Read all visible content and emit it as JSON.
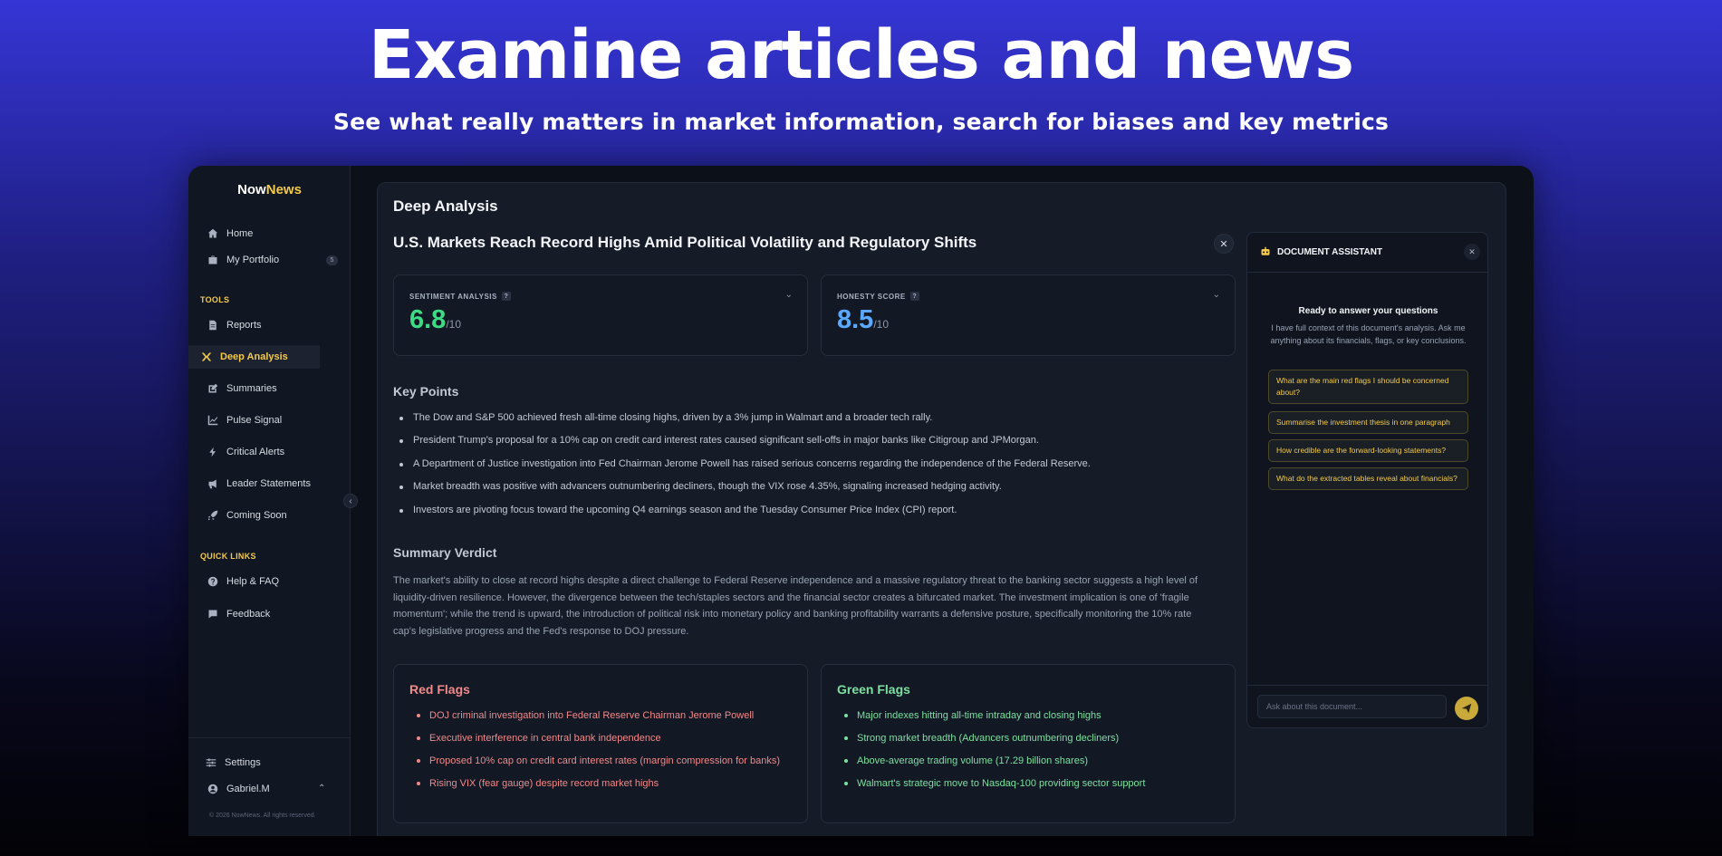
{
  "hero": {
    "title": "Examine articles and news",
    "subtitle": "See what really matters in market information, search for biases and key metrics"
  },
  "brand": {
    "prefix": "Now",
    "highlight": "News"
  },
  "sidebar": {
    "items": [
      {
        "label": "Home",
        "icon": "home-icon"
      },
      {
        "label": "My Portfolio",
        "icon": "briefcase-icon",
        "badge": "5"
      }
    ],
    "tools_label": "TOOLS",
    "tools": [
      {
        "label": "Reports",
        "icon": "document-icon"
      },
      {
        "label": "Deep Analysis",
        "icon": "analysis-icon",
        "active": true
      },
      {
        "label": "Summaries",
        "icon": "edit-icon"
      },
      {
        "label": "Pulse Signal",
        "icon": "chart-line-icon"
      },
      {
        "label": "Critical Alerts",
        "icon": "bolt-icon"
      },
      {
        "label": "Leader Statements",
        "icon": "megaphone-icon"
      },
      {
        "label": "Coming Soon",
        "icon": "rocket-icon"
      }
    ],
    "quick_links_label": "QUICK LINKS",
    "quick_links": [
      {
        "label": "Help & FAQ",
        "icon": "help-icon"
      },
      {
        "label": "Feedback",
        "icon": "chat-icon"
      }
    ],
    "settings_label": "Settings",
    "user_name": "Gabriel.M",
    "copyright": "© 2026 NowNews. All rights reserved."
  },
  "main": {
    "panel_title": "Deep Analysis",
    "article_title": "U.S. Markets Reach Record Highs Amid Political Volatility and Regulatory Shifts",
    "sentiment": {
      "label": "SENTIMENT ANALYSIS",
      "value": "6.8",
      "denominator": "/10",
      "color": "#3ddc84"
    },
    "honesty": {
      "label": "HONESTY SCORE",
      "value": "8.5",
      "denominator": "/10",
      "color": "#5aa9ff"
    },
    "key_points_title": "Key Points",
    "key_points": [
      "The Dow and S&P 500 achieved fresh all-time closing highs, driven by a 3% jump in Walmart and a broader tech rally.",
      "President Trump's proposal for a 10% cap on credit card interest rates caused significant sell-offs in major banks like Citigroup and JPMorgan.",
      "A Department of Justice investigation into Fed Chairman Jerome Powell has raised serious concerns regarding the independence of the Federal Reserve.",
      "Market breadth was positive with advancers outnumbering decliners, though the VIX rose 4.35%, signaling increased hedging activity.",
      "Investors are pivoting focus toward the upcoming Q4 earnings season and the Tuesday Consumer Price Index (CPI) report."
    ],
    "verdict_title": "Summary Verdict",
    "verdict": "The market's ability to close at record highs despite a direct challenge to Federal Reserve independence and a massive regulatory threat to the banking sector suggests a high level of liquidity-driven resilience. However, the divergence between the tech/staples sectors and the financial sector creates a bifurcated market. The investment implication is one of 'fragile momentum'; while the trend is upward, the introduction of political risk into monetary policy and banking profitability warrants a defensive posture, specifically monitoring the 10% rate cap's legislative progress and the Fed's response to DOJ pressure.",
    "red_flags_title": "Red Flags",
    "red_flags": [
      "DOJ criminal investigation into Federal Reserve Chairman Jerome Powell",
      "Executive interference in central bank independence",
      "Proposed 10% cap on credit card interest rates (margin compression for banks)",
      "Rising VIX (fear gauge) despite record market highs"
    ],
    "green_flags_title": "Green Flags",
    "green_flags": [
      "Major indexes hitting all-time intraday and closing highs",
      "Strong market breadth (Advancers outnumbering decliners)",
      "Above-average trading volume (17.29 billion shares)",
      "Walmart's strategic move to Nasdaq-100 providing sector support"
    ]
  },
  "assistant": {
    "title": "DOCUMENT ASSISTANT",
    "ready_title": "Ready to answer your questions",
    "ready_sub": "I have full context of this document's analysis. Ask me anything about its financials, flags, or key conclusions.",
    "suggestions": [
      "What are the main red flags I should be concerned about?",
      "Summarise the investment thesis in one paragraph",
      "How credible are the forward-looking statements?",
      "What do the extracted tables reveal about financials?"
    ],
    "input_placeholder": "Ask about this document...",
    "input_value": ""
  },
  "colors": {
    "accent": "#f2c94c",
    "red": "#f08a8a",
    "green": "#7ee0a0"
  }
}
